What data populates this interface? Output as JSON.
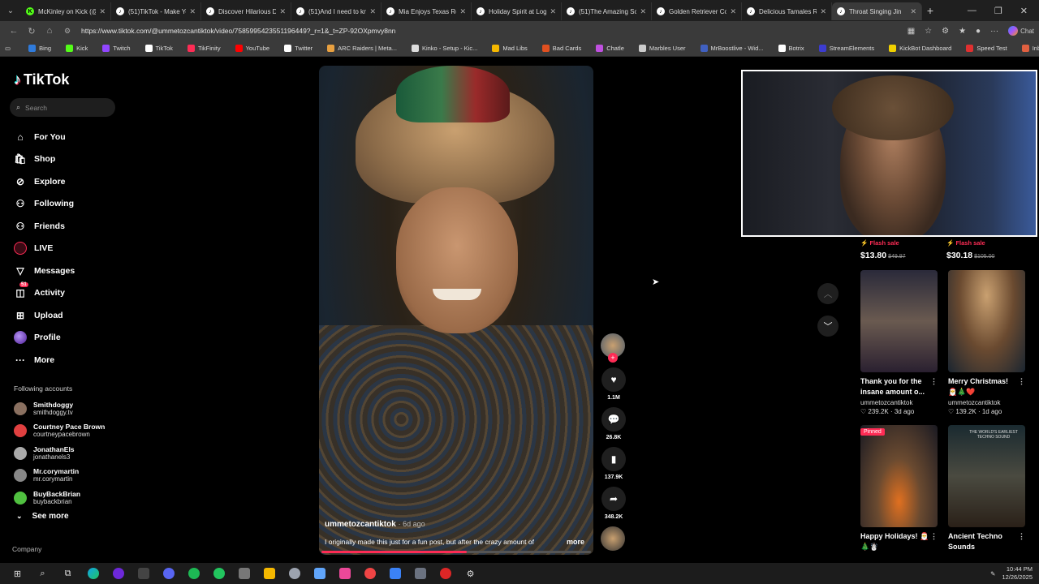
{
  "browser": {
    "tabs": [
      {
        "title": "McKinley on Kick (@m",
        "fav": "K",
        "color": "#53fc18"
      },
      {
        "title": "(51)TikTok - Make You",
        "fav": "♪",
        "color": "#ffffff"
      },
      {
        "title": "Discover Hilarious Dad",
        "fav": "♪",
        "color": "#ffffff"
      },
      {
        "title": "(51)And I need to know",
        "fav": "♪",
        "color": "#ffffff"
      },
      {
        "title": "Mia Enjoys Texas Road",
        "fav": "♪",
        "color": "#ffffff"
      },
      {
        "title": "Holiday Spirit at Logan",
        "fav": "♪",
        "color": "#ffffff"
      },
      {
        "title": "(51)The Amazing Scien",
        "fav": "♪",
        "color": "#ffffff"
      },
      {
        "title": "Golden Retriever Core",
        "fav": "♪",
        "color": "#ffffff"
      },
      {
        "title": "Delicious Tamales Reci",
        "fav": "♪",
        "color": "#ffffff"
      },
      {
        "title": "Throat Singing Jin",
        "fav": "♪",
        "color": "#ffffff",
        "active": true
      }
    ],
    "url": "https://www.tiktok.com/@ummetozcantiktok/video/7585995423551196449?_r=1&_t=ZP-92OXpmvy8nn",
    "chat_label": "Chat",
    "bookmarks": [
      {
        "label": "Bing",
        "color": "#2f7bdc"
      },
      {
        "label": "Kick",
        "color": "#53fc18"
      },
      {
        "label": "Twitch",
        "color": "#9146ff"
      },
      {
        "label": "TikTok",
        "color": "#ffffff"
      },
      {
        "label": "TikFinity",
        "color": "#fe2c55"
      },
      {
        "label": "YouTube",
        "color": "#ff0000"
      },
      {
        "label": "Twitter",
        "color": "#ffffff"
      },
      {
        "label": "ARC Raiders | Meta...",
        "color": "#e8a040"
      },
      {
        "label": "Kinko - Setup - Kic...",
        "color": "#dddddd"
      },
      {
        "label": "Mad Libs",
        "color": "#f5b800"
      },
      {
        "label": "Bad Cards",
        "color": "#e05020"
      },
      {
        "label": "Chatle",
        "color": "#c050e0"
      },
      {
        "label": "Marbles User",
        "color": "#cccccc"
      },
      {
        "label": "MrBoostlive - Wid...",
        "color": "#4060c0"
      },
      {
        "label": "Botrix",
        "color": "#ffffff"
      },
      {
        "label": "StreamElements",
        "color": "#3c3cd0"
      },
      {
        "label": "KickBot Dashboard",
        "color": "#f0d000"
      },
      {
        "label": "Speed Test",
        "color": "#e03030"
      },
      {
        "label": "Inbox",
        "color": "#e06040"
      }
    ]
  },
  "tiktok": {
    "logo": "TikTok",
    "search_placeholder": "Search",
    "nav": [
      {
        "label": "For You",
        "icon": "home-icon",
        "glyph": "⌂"
      },
      {
        "label": "Shop",
        "icon": "shop-icon",
        "glyph": "🛍"
      },
      {
        "label": "Explore",
        "icon": "compass-icon",
        "glyph": "⊘"
      },
      {
        "label": "Following",
        "icon": "person-add-icon",
        "glyph": "⚇"
      },
      {
        "label": "Friends",
        "icon": "friends-icon",
        "glyph": "⚇"
      },
      {
        "label": "LIVE",
        "icon": "live-icon",
        "glyph": ""
      },
      {
        "label": "Messages",
        "icon": "send-icon",
        "glyph": "▽"
      },
      {
        "label": "Activity",
        "icon": "inbox-icon",
        "glyph": "◫",
        "badge": "51"
      },
      {
        "label": "Upload",
        "icon": "upload-icon",
        "glyph": "⊞"
      },
      {
        "label": "Profile",
        "icon": "profile-icon",
        "glyph": ""
      },
      {
        "label": "More",
        "icon": "more-icon",
        "glyph": "···"
      }
    ],
    "following_title": "Following accounts",
    "following": [
      {
        "name": "Smithdoggy",
        "handle": "smithdoggy.tv",
        "color": "#8a7060"
      },
      {
        "name": "Courtney Pace Brown",
        "handle": "courtneypacebrown",
        "color": "#e04040"
      },
      {
        "name": "JonathanEls",
        "handle": "jonathanels3",
        "color": "#aaaaaa"
      },
      {
        "name": "Mr.corymartin",
        "handle": "mr.corymartin",
        "color": "#888888"
      },
      {
        "name": "BuyBackBrian",
        "handle": "buybackbrian",
        "color": "#50c040"
      }
    ],
    "see_more": "See more",
    "company": "Company",
    "video": {
      "author": "ummetozcantiktok",
      "age": "· 6d ago",
      "caption": "I originally made this just for a fun post, but after the crazy amount of",
      "more": "more",
      "progress": 0.54
    },
    "actions": {
      "likes": "1.1M",
      "comments": "26.8K",
      "saves": "137.9K",
      "shares": "348.2K"
    },
    "flash": [
      {
        "label": "Flash sale",
        "price": "$13.80",
        "old": "$49.97"
      },
      {
        "label": "Flash sale",
        "price": "$30.18",
        "old": "$105.00"
      }
    ],
    "cards": [
      {
        "title": "Thank you for the insane amount o...",
        "author": "ummetozcantiktok",
        "meta": "♡ 239.2K · 3d ago",
        "bg": "linear-gradient(180deg,#2a2a3a,#6a5a50 50%,#2a2030)",
        "pinned": "",
        "cap": ""
      },
      {
        "title": "Merry Christmas! 🎅🎄❤️",
        "author": "ummetozcantiktok",
        "meta": "♡ 139.2K · 1d ago",
        "bg": "radial-gradient(ellipse at 50% 25%,#c9a070,#6a4a30 50%,#1a2530)",
        "pinned": "",
        "cap": ""
      },
      {
        "title": "Happy Holidays! 🎅🎄☃️",
        "author": "",
        "meta": "",
        "bg": "radial-gradient(ellipse at 50% 75%,#e07020,#6a4a30 40%,#1a1a22)",
        "pinned": "Pinned",
        "cap": ""
      },
      {
        "title": "Ancient Techno Sounds",
        "author": "",
        "meta": "",
        "bg": "linear-gradient(180deg,#1a2a30,#4a4a40 50%,#2a2018)",
        "pinned": "",
        "cap": "THE WORLD'S EARLIEST TECHNO SOUND"
      }
    ]
  },
  "taskbar": {
    "time": "10:44 PM",
    "date": "12/26/2025"
  }
}
